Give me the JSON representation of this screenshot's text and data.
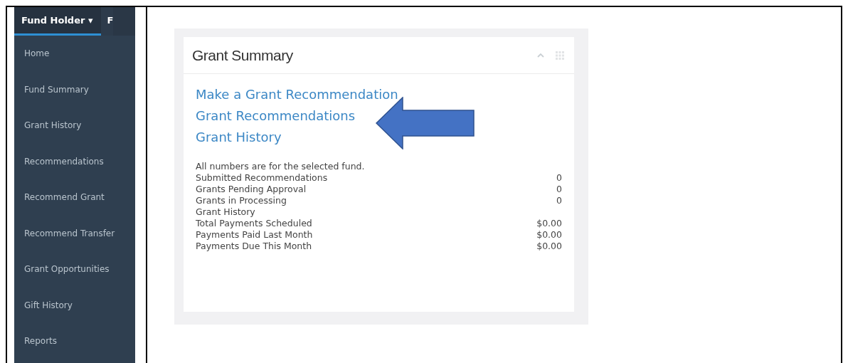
{
  "sidebar": {
    "tabs": [
      {
        "label": "Fund Holder",
        "caret": "▾",
        "selected": true
      },
      {
        "label": "F",
        "selected": false
      }
    ],
    "items": [
      {
        "label": "Home"
      },
      {
        "label": "Fund Summary"
      },
      {
        "label": "Grant History"
      },
      {
        "label": "Recommendations"
      },
      {
        "label": "Recommend Grant"
      },
      {
        "label": "Recommend Transfer"
      },
      {
        "label": "Grant Opportunities"
      },
      {
        "label": "Gift History"
      },
      {
        "label": "Reports"
      }
    ]
  },
  "card": {
    "title": "Grant Summary",
    "links": [
      "Make a Grant Recommendation",
      "Grant Recommendations",
      "Grant History"
    ],
    "note": "All numbers are for the selected fund.",
    "rows": [
      {
        "label": "Submitted Recommendations",
        "value": "0"
      },
      {
        "label": "Grants Pending Approval",
        "value": "0"
      },
      {
        "label": "Grants in Processing",
        "value": "0"
      },
      {
        "label": "Grant History"
      },
      {
        "label": "Total Payments Scheduled",
        "value": "$0.00"
      },
      {
        "label": "Payments Paid Last Month",
        "value": "$0.00"
      },
      {
        "label": "Payments Due This Month",
        "value": "$0.00"
      }
    ]
  }
}
